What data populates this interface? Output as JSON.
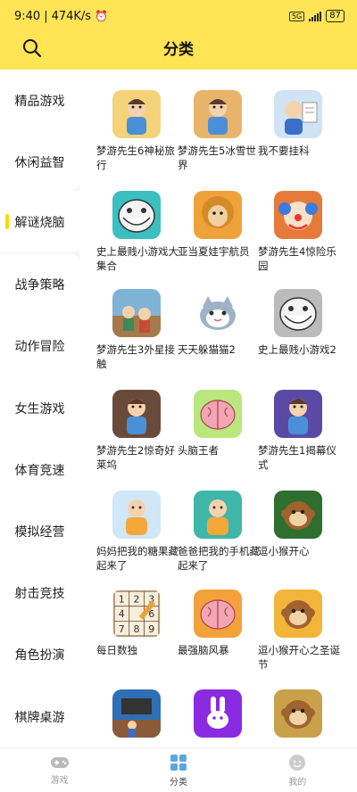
{
  "status": {
    "time": "9:40",
    "speed": "474K/s",
    "battery": "87",
    "net": "5G"
  },
  "header": {
    "title": "分类"
  },
  "categories": [
    "精品游戏",
    "休闲益智",
    "解谜烧脑",
    "战争策略",
    "动作冒险",
    "女生游戏",
    "体育竞速",
    "模拟经营",
    "射击竞技",
    "角色扮演",
    "棋牌桌游"
  ],
  "games": [
    {
      "name": "梦游先生6神秘旅行",
      "icon": "cartoon-man-icon",
      "bg": "#f4d27a"
    },
    {
      "name": "梦游先生5冰雪世界",
      "icon": "cartoon-man-icon",
      "bg": "#e8b46a"
    },
    {
      "name": "我不要挂科",
      "icon": "student-icon",
      "bg": "#cfe3f5"
    },
    {
      "name": "史上最贱小游戏大集合",
      "icon": "troll-face-icon",
      "bg": "#3bbfbf"
    },
    {
      "name": "亚当夏娃宇航员",
      "icon": "caveman-icon",
      "bg": "#f0a23a"
    },
    {
      "name": "梦游先生4惊险乐园",
      "icon": "clown-icon",
      "bg": "#e57a3a"
    },
    {
      "name": "梦游先生3外星接触",
      "icon": "cartoon-scene-icon",
      "bg": "#7fb3d6"
    },
    {
      "name": "天天躲猫猫2",
      "icon": "cat-icon",
      "bg": "#ffffff"
    },
    {
      "name": "史上最贱小游戏2",
      "icon": "troll-face-icon",
      "bg": "#bbbbbb"
    },
    {
      "name": "梦游先生2惊奇好莱坞",
      "icon": "cartoon-man-icon",
      "bg": "#6a4a3a"
    },
    {
      "name": "头脑王者",
      "icon": "brain-icon",
      "bg": "#b9e67d"
    },
    {
      "name": "梦游先生1揭幕仪式",
      "icon": "cartoon-man-icon",
      "bg": "#5a4aa5"
    },
    {
      "name": "妈妈把我的糖果藏起来了",
      "icon": "kid-icon",
      "bg": "#cfe7f7"
    },
    {
      "name": "爸爸把我的手机藏起来了",
      "icon": "kid-icon",
      "bg": "#3fb6a8"
    },
    {
      "name": "逗小猴开心",
      "icon": "monkey-icon",
      "bg": "#2e6e2e"
    },
    {
      "name": "每日数独",
      "icon": "sudoku-icon",
      "bg": "#f7eedc"
    },
    {
      "name": "最强脑风暴",
      "icon": "brain-icon",
      "bg": "#f3a13a"
    },
    {
      "name": "逗小猴开心之圣诞节",
      "icon": "monkey-icon",
      "bg": "#f3b43a"
    },
    {
      "name": "",
      "icon": "room-scene-icon",
      "bg": "#2f6fb5"
    },
    {
      "name": "",
      "icon": "bunny-icon",
      "bg": "#8a2be2"
    },
    {
      "name": "",
      "icon": "monkey-icon",
      "bg": "#c9a14a"
    }
  ],
  "sudoku": [
    "1",
    "2",
    "3",
    "4",
    "",
    "6",
    "7",
    "8",
    "9"
  ],
  "nav": [
    {
      "label": "游戏",
      "icon": "gamepad-icon"
    },
    {
      "label": "分类",
      "icon": "grid-icon"
    },
    {
      "label": "我的",
      "icon": "face-icon"
    }
  ],
  "colors": {
    "accent": "#ffe555",
    "indicator": "#ffd600"
  }
}
